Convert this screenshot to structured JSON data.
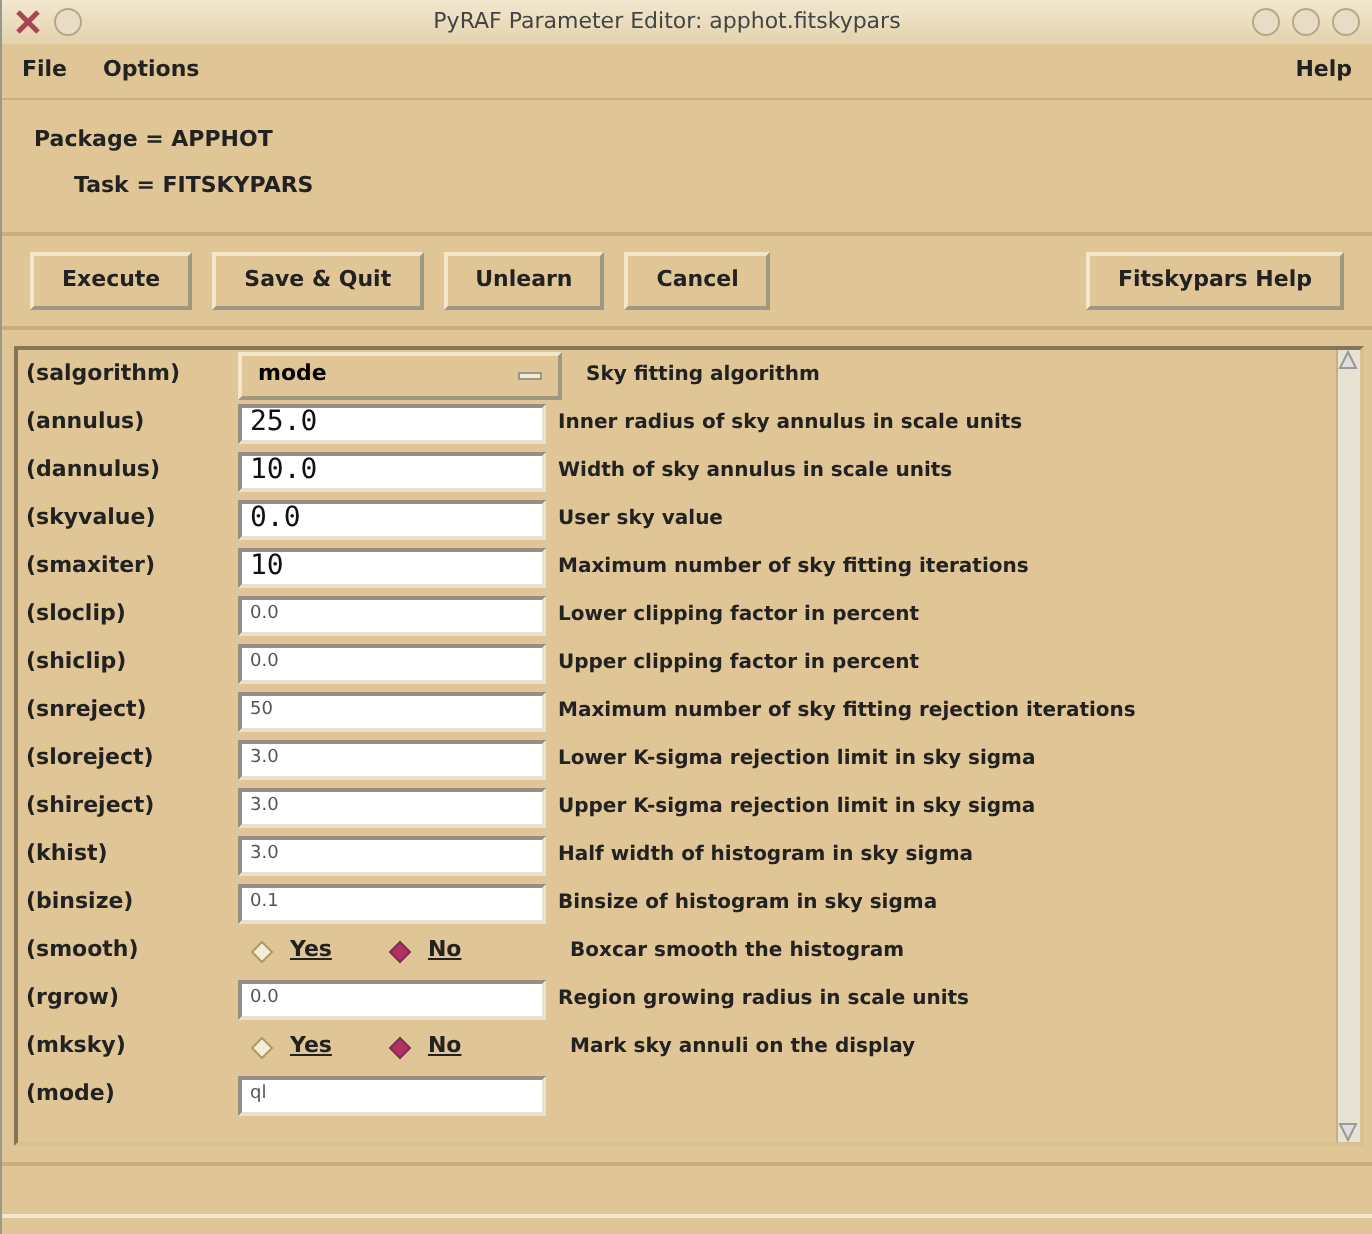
{
  "window": {
    "title": "PyRAF Parameter Editor:   apphot.fitskypars"
  },
  "menu": {
    "left": [
      "File",
      "Options"
    ],
    "right": "Help"
  },
  "info": {
    "package": "Package = APPHOT",
    "task": "Task = FITSKYPARS"
  },
  "buttons": [
    "Execute",
    "Save & Quit",
    "Unlearn",
    "Cancel"
  ],
  "help_button": "Fitskypars Help",
  "params": [
    {
      "kind": "choice",
      "name": "(salgorithm)",
      "value": "mode",
      "description": "Sky fitting algorithm"
    },
    {
      "kind": "entry",
      "name": "(annulus)",
      "value": "25.0",
      "modified": true,
      "description": "Inner radius of sky annulus in scale units"
    },
    {
      "kind": "entry",
      "name": "(dannulus)",
      "value": "10.0",
      "modified": true,
      "description": "Width of sky annulus in scale units"
    },
    {
      "kind": "entry",
      "name": "(skyvalue)",
      "value": "0.0",
      "modified": true,
      "description": "User sky value"
    },
    {
      "kind": "entry",
      "name": "(smaxiter)",
      "value": "10",
      "modified": true,
      "description": "Maximum number of sky fitting iterations"
    },
    {
      "kind": "entry",
      "name": "(sloclip)",
      "value": "0.0",
      "modified": false,
      "description": "Lower clipping factor in percent"
    },
    {
      "kind": "entry",
      "name": "(shiclip)",
      "value": "0.0",
      "modified": false,
      "description": "Upper clipping factor in percent"
    },
    {
      "kind": "entry",
      "name": "(snreject)",
      "value": "50",
      "modified": false,
      "description": "Maximum number of sky fitting rejection iterations"
    },
    {
      "kind": "entry",
      "name": "(sloreject)",
      "value": "3.0",
      "modified": false,
      "description": "Lower K-sigma rejection limit in sky sigma"
    },
    {
      "kind": "entry",
      "name": "(shireject)",
      "value": "3.0",
      "modified": false,
      "description": "Upper K-sigma rejection limit in sky sigma"
    },
    {
      "kind": "entry",
      "name": "(khist)",
      "value": "3.0",
      "modified": false,
      "description": "Half width of histogram in sky sigma"
    },
    {
      "kind": "entry",
      "name": "(binsize)",
      "value": "0.1",
      "modified": false,
      "description": "Binsize of histogram in sky sigma"
    },
    {
      "kind": "bool",
      "name": "(smooth)",
      "options": [
        {
          "label": "Yes",
          "selected": false
        },
        {
          "label": "No",
          "selected": true
        }
      ],
      "description": "Boxcar smooth the histogram"
    },
    {
      "kind": "entry",
      "name": "(rgrow)",
      "value": "0.0",
      "modified": false,
      "description": "Region growing radius in scale units"
    },
    {
      "kind": "bool",
      "name": "(mksky)",
      "options": [
        {
          "label": "Yes",
          "selected": false
        },
        {
          "label": "No",
          "selected": true
        }
      ],
      "description": "Mark sky annuli on the display"
    },
    {
      "kind": "entry",
      "name": "(mode)",
      "value": "ql",
      "modified": false
    }
  ]
}
